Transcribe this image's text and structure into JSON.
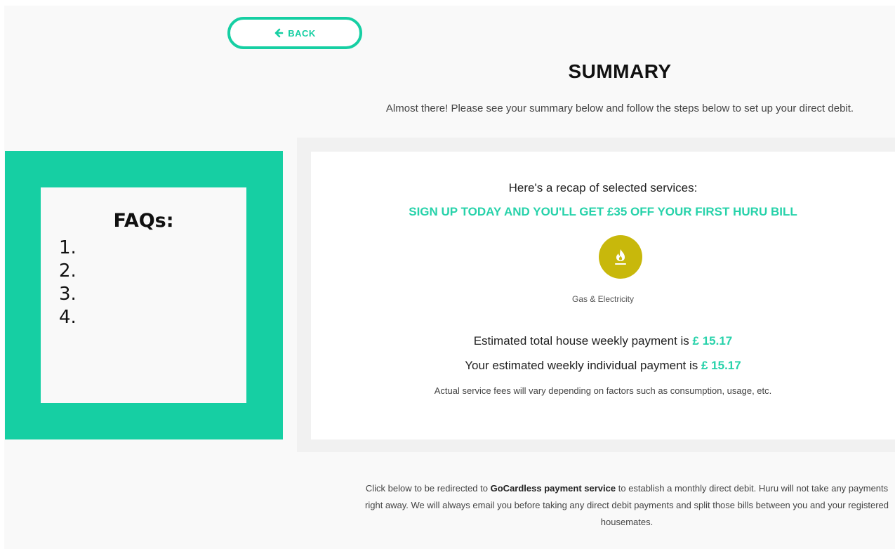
{
  "header": {
    "back_label": "BACK",
    "title": "SUMMARY",
    "subtitle": "Almost there! Please see your summary below and follow the steps below to set up your direct debit."
  },
  "faq": {
    "title": "FAQs:",
    "items": [
      "1.",
      "2.",
      "3.",
      "4."
    ]
  },
  "summary": {
    "recap_heading": "Here's a recap of selected services:",
    "promo": "SIGN UP TODAY AND YOU'LL GET £35 OFF YOUR FIRST HURU BILL",
    "service": {
      "icon": "flame-icon",
      "label": "Gas & Electricity"
    },
    "total_payment_text": "Estimated total house weekly payment is",
    "total_payment_amount": "£ 15.17",
    "individual_payment_text": "Your estimated weekly individual payment is",
    "individual_payment_amount": "£ 15.17",
    "fees_note": "Actual service fees will vary depending on factors such as consumption, usage, etc."
  },
  "footer": {
    "note_before": "Click below to be redirected to",
    "note_bold": "GoCardless payment service",
    "note_after": "to establish a monthly direct debit. Huru will not take any payments right away. We will always email you before taking any direct debit payments and split those bills between you and your registered housemates."
  },
  "colors": {
    "accent": "#16cfa3",
    "service_icon_bg": "#c8b80b"
  }
}
